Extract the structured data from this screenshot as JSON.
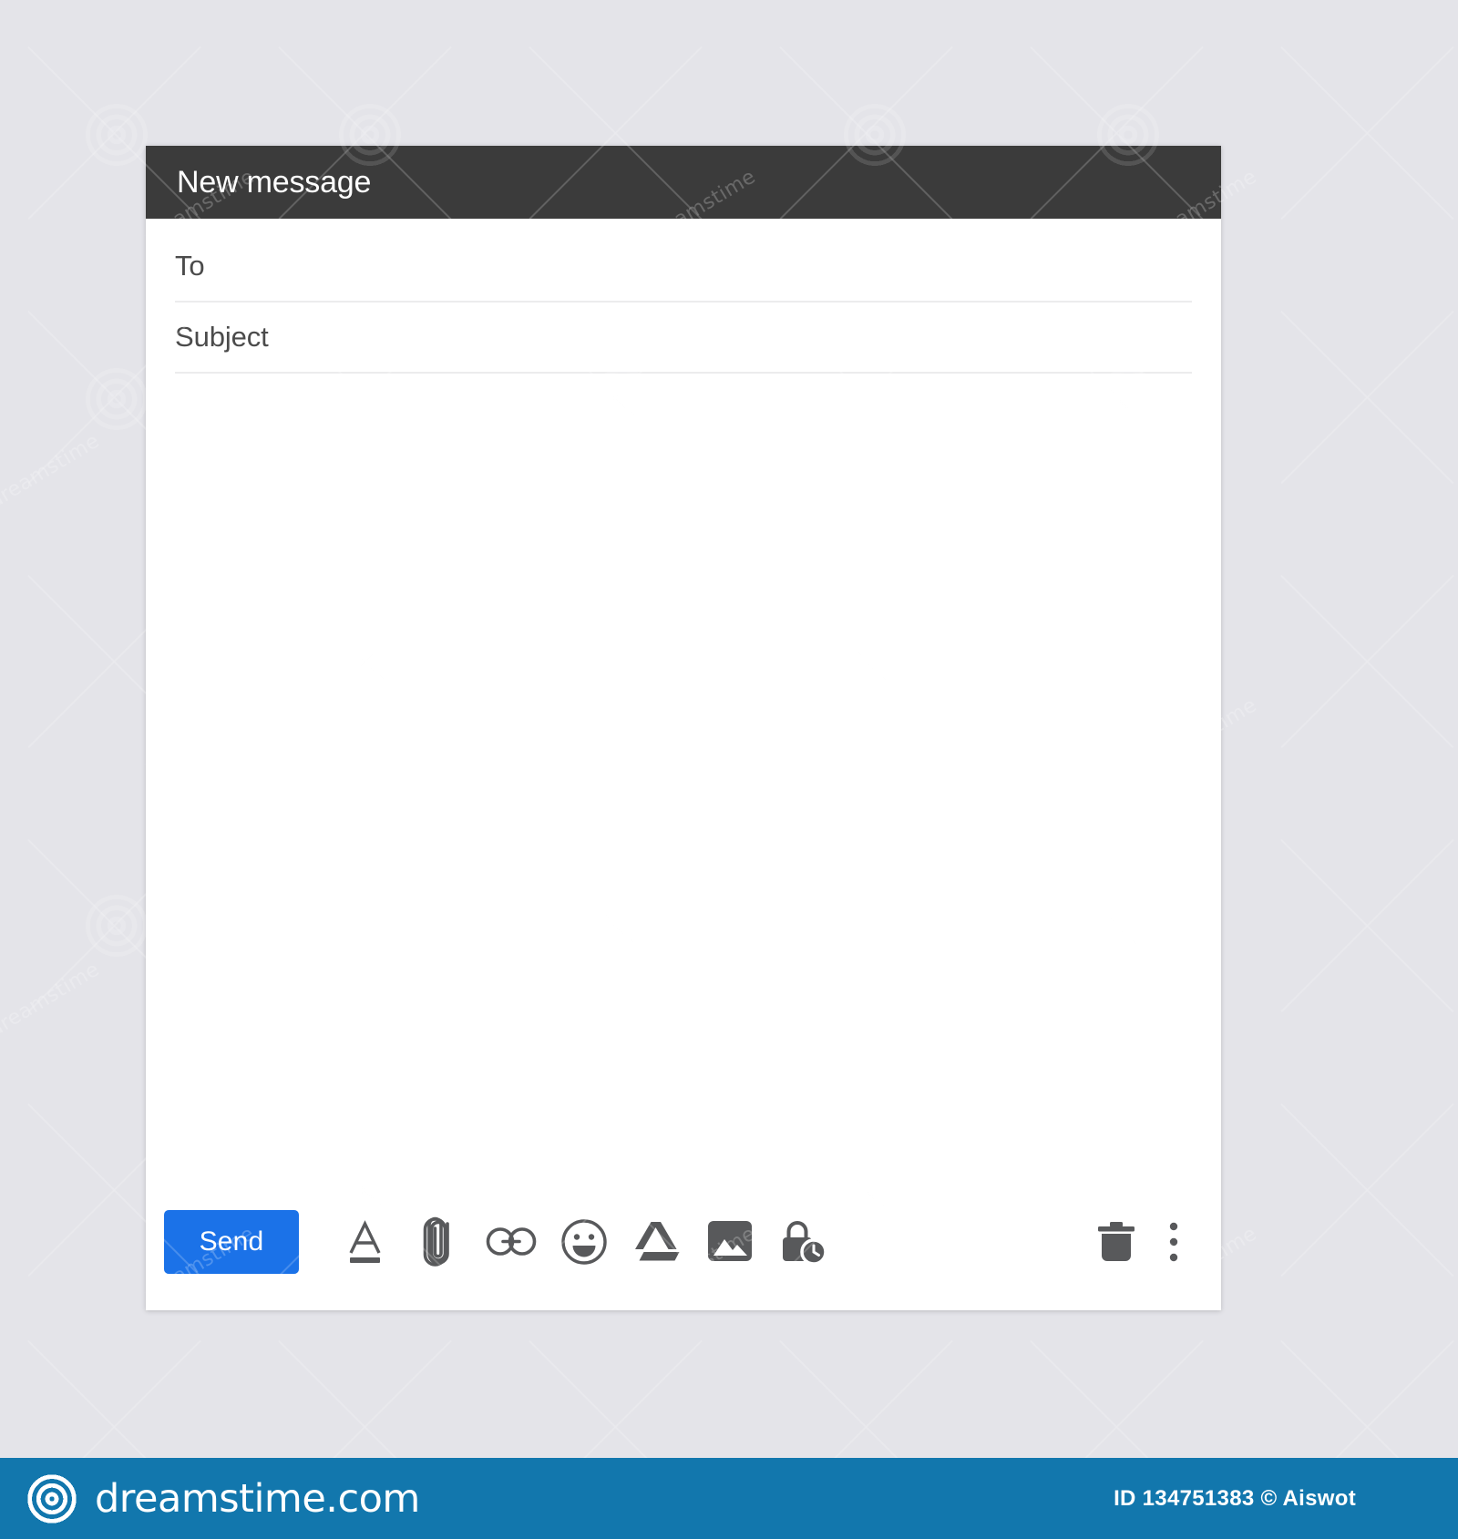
{
  "theme": {
    "page_background": "#e4e4e9",
    "header_background": "#3b3b3b",
    "window_background": "#ffffff",
    "accent_send": "#1b72e8",
    "icon_color": "#58595b",
    "divider_color": "#ececed",
    "brand_bar_background": "#1277ad"
  },
  "compose": {
    "header": {
      "title": "New message"
    },
    "fields": [
      {
        "label": "To",
        "value": "",
        "placeholder": "To"
      },
      {
        "label": "Subject",
        "value": "",
        "placeholder": "Subject"
      }
    ],
    "body": {
      "value": "",
      "placeholder": ""
    },
    "footer": {
      "send_label": "Send",
      "tools": [
        {
          "name": "format-text-icon",
          "label": "Formatting options"
        },
        {
          "name": "paperclip-icon",
          "label": "Attach files"
        },
        {
          "name": "link-icon",
          "label": "Insert link"
        },
        {
          "name": "emoji-icon",
          "label": "Insert emoji"
        },
        {
          "name": "google-drive-icon",
          "label": "Insert files using Drive"
        },
        {
          "name": "image-icon",
          "label": "Insert photo"
        },
        {
          "name": "lock-clock-icon",
          "label": "Toggle confidential mode"
        }
      ],
      "right_tools": [
        {
          "name": "trash-icon",
          "label": "Discard draft"
        },
        {
          "name": "more-options-icon",
          "label": "More options"
        }
      ]
    }
  },
  "brand_bar": {
    "logo_name": "dreamstime-spiral-logo",
    "site_name": "dreamstime.com",
    "credit": "ID 134751383 © Aiswot"
  },
  "watermark": {
    "word": "dreamstime",
    "logo_name": "dreamstime-spiral-watermark"
  }
}
